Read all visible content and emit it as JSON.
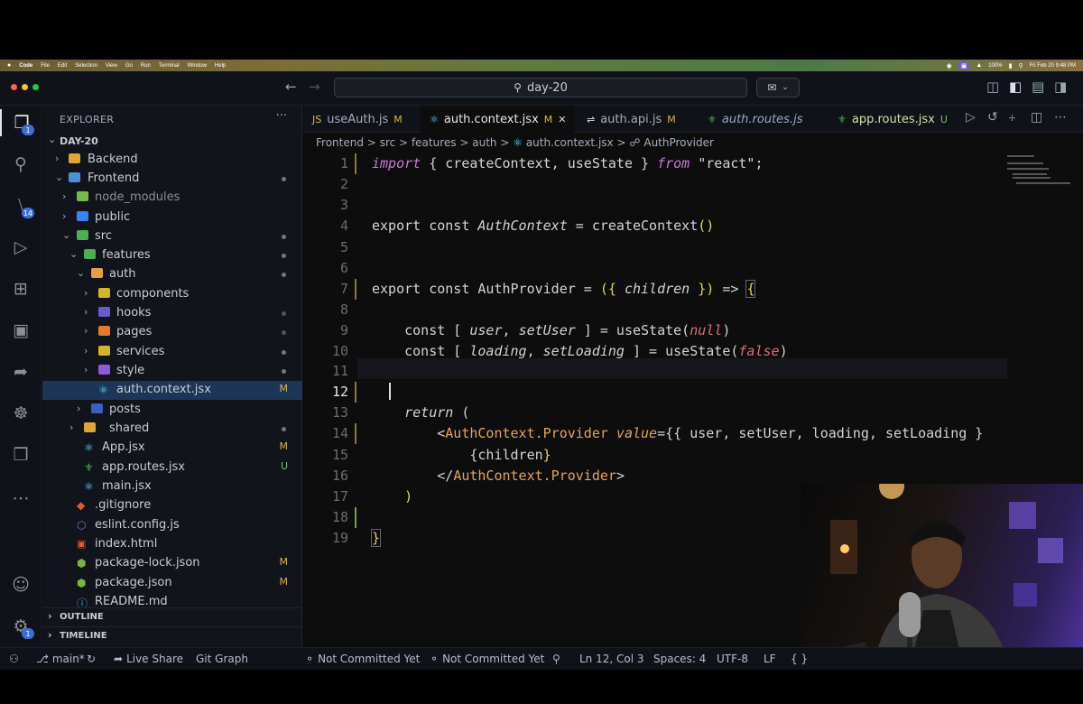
{
  "mac_menu": {
    "items": [
      "Code",
      "File",
      "Edit",
      "Selection",
      "View",
      "Go",
      "Run",
      "Terminal",
      "Window",
      "Help"
    ],
    "battery": "100%",
    "datetime": "Fri Feb 20 9:48 PM"
  },
  "titlebar": {
    "search_text": "day-20"
  },
  "activity": {
    "explorer_badge": "1",
    "scm_badge": "14",
    "settings_badge": "1"
  },
  "explorer": {
    "title": "EXPLORER",
    "more": "···",
    "root": "DAY-20",
    "outline": "OUTLINE",
    "timeline": "TIMELINE",
    "rows": [
      {
        "label": "Backend",
        "status": ""
      },
      {
        "label": "Frontend",
        "status": ""
      },
      {
        "label": "node_modules",
        "status": ""
      },
      {
        "label": "public",
        "status": ""
      },
      {
        "label": "src",
        "status": ""
      },
      {
        "label": "features",
        "status": ""
      },
      {
        "label": "auth",
        "status": ""
      },
      {
        "label": "components",
        "status": ""
      },
      {
        "label": "hooks",
        "status": ""
      },
      {
        "label": "pages",
        "status": ""
      },
      {
        "label": "services",
        "status": ""
      },
      {
        "label": "style",
        "status": ""
      },
      {
        "label": "auth.context.jsx",
        "status": "M"
      },
      {
        "label": "posts",
        "status": ""
      },
      {
        "label": "shared",
        "status": ""
      },
      {
        "label": "App.jsx",
        "status": "M"
      },
      {
        "label": "app.routes.jsx",
        "status": "U"
      },
      {
        "label": "main.jsx",
        "status": ""
      },
      {
        "label": ".gitignore",
        "status": ""
      },
      {
        "label": "eslint.config.js",
        "status": ""
      },
      {
        "label": "index.html",
        "status": ""
      },
      {
        "label": "package-lock.json",
        "status": "M"
      },
      {
        "label": "package.json",
        "status": "M"
      },
      {
        "label": "README.md",
        "status": ""
      }
    ]
  },
  "tabs": [
    {
      "label": "useAuth.js",
      "status": "M"
    },
    {
      "label": "auth.context.jsx",
      "status": "M",
      "close": "✕"
    },
    {
      "label": "auth.api.js",
      "status": "M"
    },
    {
      "label": "auth.routes.js",
      "status": ""
    },
    {
      "label": "app.routes.jsx",
      "status": "U"
    }
  ],
  "breadcrumb": {
    "parts": [
      "Frontend",
      "src",
      "features",
      "auth",
      "auth.context.jsx",
      "AuthProvider"
    ],
    "sep": ">"
  },
  "editor": {
    "line_numbers": [
      "1",
      "2",
      "3",
      "4",
      "5",
      "6",
      "7",
      "8",
      "9",
      "10",
      "11",
      "12",
      "13",
      "14",
      "15",
      "16",
      "17",
      "18",
      "19"
    ],
    "code": {
      "l1a": "import",
      "l1b": " { createContext, useState } ",
      "l1c": "from",
      "l1d": " \"react\";",
      "l4a": "export const ",
      "l4b": "AuthContext",
      "l4c": " = createContext",
      "l4d": "()",
      "l7a": "export const AuthProvider = ",
      "l7b": "({ ",
      "l7c": "children",
      "l7d": " })",
      "l7e": " => ",
      "l7f": "{",
      "l9a": "    const [ ",
      "l9b": "user",
      "l9c": ", ",
      "l9d": "setUser",
      "l9e": " ] = useState(",
      "l9f": "null",
      "l9g": ")",
      "l10a": "    const [ ",
      "l10b": "loading",
      "l10c": ", ",
      "l10d": "setLoading",
      "l10e": " ] = useState(",
      "l10f": "false",
      "l10g": ")",
      "l13a": "    ",
      "l13b": "return",
      "l13c": " (",
      "l14a": "        <",
      "l14b": "AuthContext.Provider",
      "l14c": " value",
      "l14d": "={{ user, setUser, loading, setLoading }",
      "l15a": "            {children",
      "l15b": "}",
      "l16a": "        </",
      "l16b": "AuthContext.Provider",
      "l16c": ">",
      "l17a": "    )",
      "l19a": "}"
    }
  },
  "status": {
    "branch": "main*",
    "live_share": "Live Share",
    "git_graph": "Git Graph",
    "not_committed_1": "Not Committed Yet",
    "not_committed_2": "Not Committed Yet",
    "position": "Ln 12, Col 3",
    "spaces": "Spaces: 4",
    "encoding": "UTF-8",
    "eol": "LF",
    "lang": "{ }"
  }
}
